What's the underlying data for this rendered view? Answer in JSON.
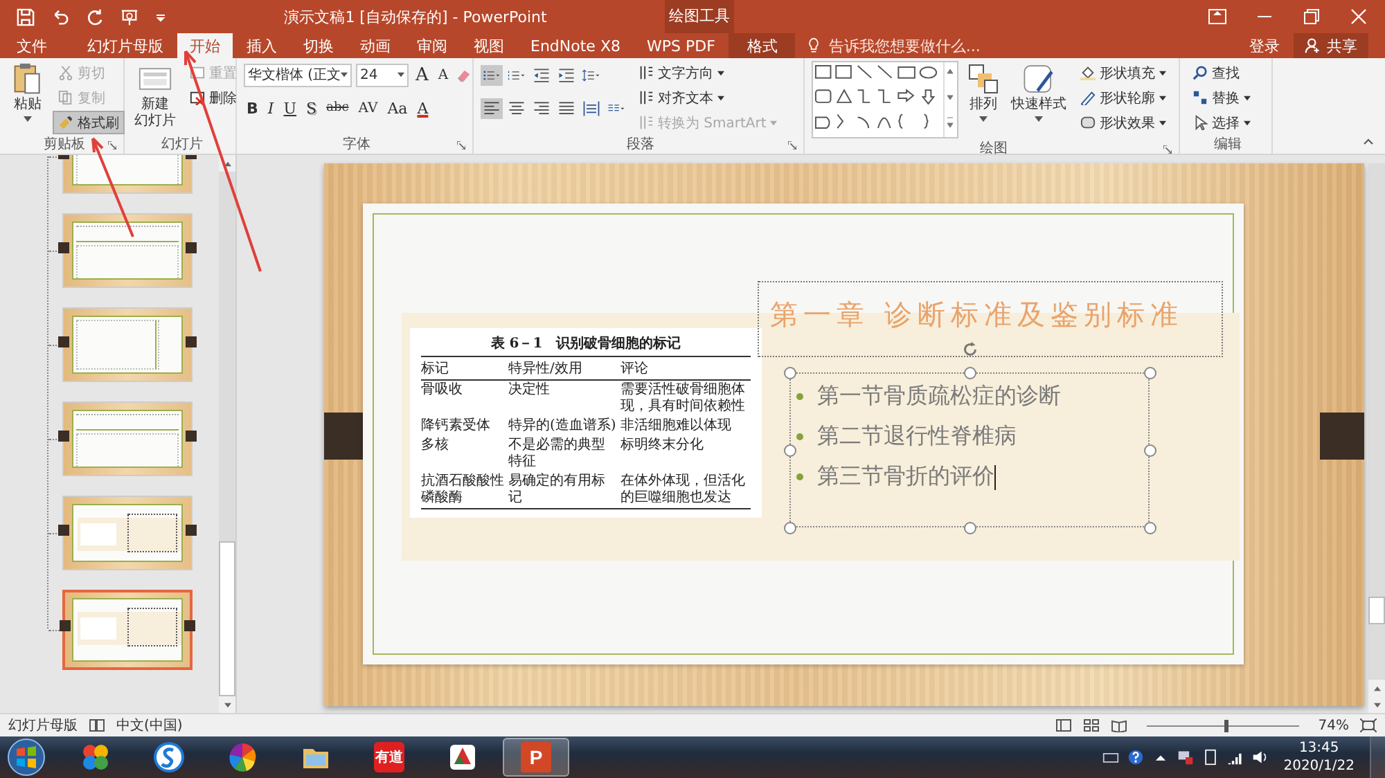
{
  "title_bar": {
    "title": "演示文稿1 [自动保存的] - PowerPoint",
    "context_group": "绘图工具"
  },
  "tabs": [
    {
      "label": "文件",
      "selected": false,
      "kind": "main"
    },
    {
      "label": "幻灯片母版",
      "selected": false,
      "kind": "main"
    },
    {
      "label": "开始",
      "selected": true,
      "kind": "main"
    },
    {
      "label": "插入",
      "selected": false,
      "kind": "main"
    },
    {
      "label": "切换",
      "selected": false,
      "kind": "main"
    },
    {
      "label": "动画",
      "selected": false,
      "kind": "main"
    },
    {
      "label": "审阅",
      "selected": false,
      "kind": "main"
    },
    {
      "label": "视图",
      "selected": false,
      "kind": "main"
    },
    {
      "label": "EndNote X8",
      "selected": false,
      "kind": "main"
    },
    {
      "label": "WPS PDF",
      "selected": false,
      "kind": "main"
    },
    {
      "label": "格式",
      "selected": false,
      "kind": "context"
    }
  ],
  "tell_me": {
    "placeholder": "告诉我您想要做什么..."
  },
  "sign_in": "登录",
  "share": "共享",
  "ribbon": {
    "clipboard": {
      "label": "剪贴板",
      "paste": "粘贴",
      "items": [
        {
          "label": "剪切",
          "disabled": true,
          "pressed": false
        },
        {
          "label": "复制",
          "disabled": true,
          "pressed": false
        },
        {
          "label": "格式刷",
          "disabled": false,
          "pressed": true
        }
      ]
    },
    "slides": {
      "label": "幻灯片",
      "new_slide": [
        "新建",
        "幻灯片"
      ],
      "items": [
        {
          "label": "重置",
          "disabled": true
        },
        {
          "label": "删除",
          "disabled": false
        }
      ]
    },
    "font": {
      "label": "字体",
      "face": "华文楷体 (正文",
      "size": "24",
      "size_buttons": [
        "A",
        "A"
      ],
      "buttons": [
        "B",
        "I",
        "U",
        "S",
        "abc",
        "AV",
        "Aa",
        "A"
      ]
    },
    "paragraph": {
      "label": "段落",
      "items": [
        {
          "label": "文字方向",
          "disabled": false
        },
        {
          "label": "对齐文本",
          "disabled": false
        },
        {
          "label": "转换为 SmartArt",
          "disabled": true
        }
      ]
    },
    "drawing": {
      "label": "绘图",
      "arrange": "排列",
      "quick_styles": "快速样式",
      "items": [
        "形状填充",
        "形状轮廓",
        "形状效果"
      ]
    },
    "editing": {
      "label": "编辑",
      "items": [
        "查找",
        "替换",
        "选择"
      ]
    }
  },
  "thumbnails": [
    {
      "kind": "title-top",
      "selected": false
    },
    {
      "kind": "title-top",
      "selected": false
    },
    {
      "kind": "title-side",
      "selected": false
    },
    {
      "kind": "title-top",
      "selected": false
    },
    {
      "kind": "band",
      "selected": false
    },
    {
      "kind": "band",
      "selected": true
    }
  ],
  "slide": {
    "title": "第一章 诊断标准及鉴别标准",
    "bullets": [
      "第一节骨质疏松症的诊断",
      "第二节退行性脊椎病",
      "第三节骨折的评价"
    ],
    "table": {
      "caption": "表 6－1　识别破骨细胞的标记",
      "columns": [
        "标记",
        "特异性/效用",
        "评论"
      ],
      "rows": [
        [
          "骨吸收",
          "决定性",
          "需要活性破骨细胞体现，具有时间依赖性"
        ],
        [
          "降钙素受体",
          "特异的(造血谱系)",
          "非活细胞难以体现"
        ],
        [
          "多核",
          "不是必需的典型特征",
          "标明终末分化"
        ],
        [
          "抗酒石酸酸性磷酸酶",
          "易确定的有用标记",
          "在体外体现，但活化的巨噬细胞也发达"
        ]
      ]
    }
  },
  "status_bar": {
    "view": "幻灯片母版",
    "language": "中文(中国)",
    "zoom": "74%",
    "zoom_slider": {
      "level": 0.52
    }
  },
  "taskbar": {
    "apps": [
      {
        "kind": "balls",
        "selected": false
      },
      {
        "kind": "sogou",
        "selected": false
      },
      {
        "kind": "pinwheel",
        "selected": false
      },
      {
        "kind": "folder",
        "selected": false
      },
      {
        "kind": "youdao",
        "label": "有道",
        "selected": false
      },
      {
        "kind": "wps",
        "selected": false
      },
      {
        "kind": "powerpoint",
        "label": "P",
        "selected": true
      }
    ],
    "time": "13:45",
    "date": "2020/1/22"
  }
}
